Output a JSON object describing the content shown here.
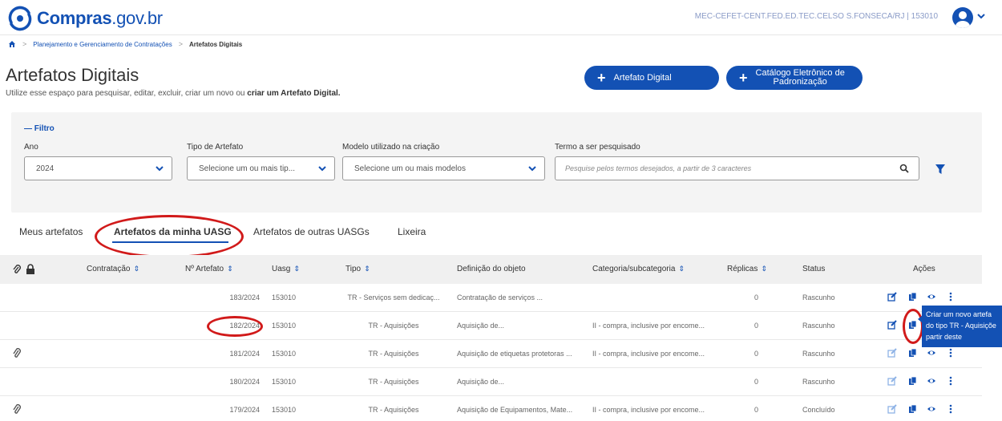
{
  "header": {
    "logo_text": "Compras",
    "logo_suffix": ".gov.br",
    "user_ident": "MEC-CEFET-CENT.FED.ED.TEC.CELSO S.FONSECA/RJ | 153010"
  },
  "breadcrumb": {
    "items": [
      "Planejamento e Gerenciamento de Contratações",
      "Artefatos Digitais"
    ]
  },
  "page": {
    "title": "Artefatos Digitais",
    "subtitle_prefix": "Utilize esse espaço para pesquisar, editar, excluir, criar um novo ou ",
    "subtitle_bold": "criar um Artefato Digital."
  },
  "buttons": {
    "artefato_digital": "Artefato Digital",
    "catalogo_line1": "Catálogo Eletrônico de",
    "catalogo_line2": "Padronização"
  },
  "filter": {
    "title": "Filtro",
    "ano_label": "Ano",
    "ano_value": "2024",
    "tipo_label": "Tipo de Artefato",
    "tipo_placeholder": "Selecione um ou mais tip...",
    "modelo_label": "Modelo utilizado na criação",
    "modelo_placeholder": "Selecione um ou mais modelos",
    "termo_label": "Termo a ser pesquisado",
    "termo_placeholder": "Pesquise pelos termos desejados, a partir de 3 caracteres"
  },
  "tabs": [
    "Meus artefatos",
    "Artefatos da minha UASG",
    "Artefatos de outras UASGs",
    "Lixeira"
  ],
  "table": {
    "headers": {
      "contratacao": "Contratação",
      "numero": "Nº Artefato",
      "uasg": "Uasg",
      "tipo": "Tipo",
      "definicao": "Definição do objeto",
      "categoria": "Categoria/subcategoria",
      "replicas": "Réplicas",
      "status": "Status",
      "acoes": "Ações"
    },
    "rows": [
      {
        "numero": "183/2024",
        "uasg": "153010",
        "tipo": "TR - Serviços sem dedicaç...",
        "definicao": "Contratação de serviços ...",
        "categoria": "",
        "replicas": "0",
        "status": "Rascunho"
      },
      {
        "numero": "182/2024",
        "uasg": "153010",
        "tipo": "TR - Aquisições",
        "definicao": "Aquisição de...",
        "categoria": "II - compra, inclusive por encome...",
        "replicas": "0",
        "status": "Rascunho"
      },
      {
        "numero": "181/2024",
        "uasg": "153010",
        "tipo": "TR - Aquisições",
        "definicao": "Aquisição de etiquetas protetoras ...",
        "categoria": "II - compra, inclusive por encome...",
        "replicas": "0",
        "status": "Rascunho"
      },
      {
        "numero": "180/2024",
        "uasg": "153010",
        "tipo": "TR - Aquisições",
        "definicao": "Aquisição de...",
        "categoria": "",
        "replicas": "0",
        "status": "Rascunho"
      },
      {
        "numero": "179/2024",
        "uasg": "153010",
        "tipo": "TR - Aquisições",
        "definicao": "Aquisição de Equipamentos, Mate...",
        "categoria": "II - compra, inclusive por encome...",
        "replicas": "0",
        "status": "Concluído"
      }
    ]
  },
  "tooltip": {
    "line1": "Criar um novo artefa",
    "line2": "do tipo TR - Aquisiçõe",
    "line3": "partir deste"
  },
  "colors": {
    "primary": "#1351b4",
    "highlight": "#d11a1a"
  }
}
